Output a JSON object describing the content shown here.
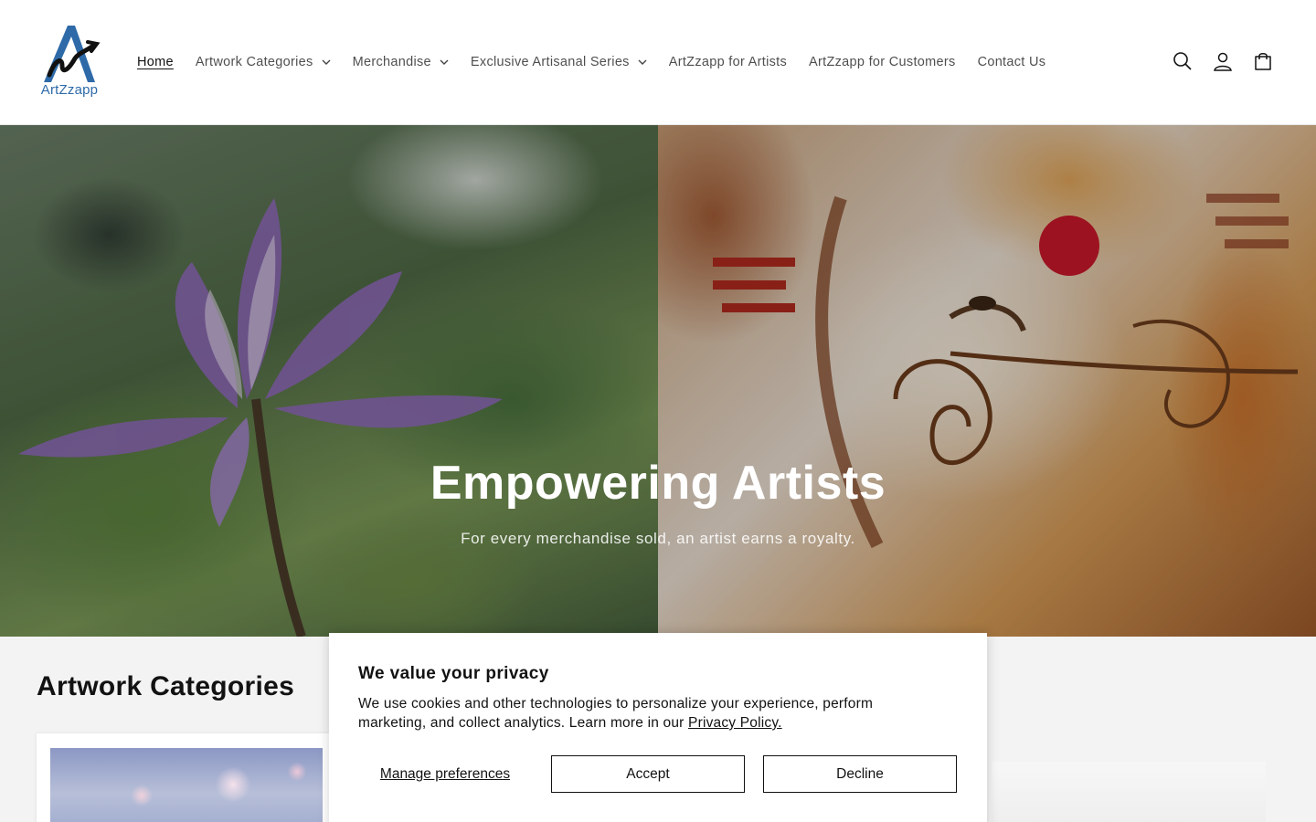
{
  "brand": {
    "name": "ArtZzapp",
    "logo_letter": "A"
  },
  "nav": {
    "items": [
      {
        "label": "Home",
        "dropdown": false,
        "active": true
      },
      {
        "label": "Artwork Categories",
        "dropdown": true
      },
      {
        "label": "Merchandise",
        "dropdown": true
      },
      {
        "label": "Exclusive Artisanal Series",
        "dropdown": true
      },
      {
        "label": "ArtZzapp for Artists",
        "dropdown": false
      },
      {
        "label": "ArtZzapp for Customers",
        "dropdown": false
      },
      {
        "label": "Contact Us",
        "dropdown": false
      }
    ],
    "icons": [
      "search-icon",
      "account-icon",
      "cart-icon"
    ]
  },
  "hero": {
    "title": "Empowering Artists",
    "subtitle": "For every merchandise sold, an artist earns a royalty."
  },
  "section": {
    "title": "Artwork Categories"
  },
  "cookie": {
    "title": "We value your privacy",
    "text": "We use cookies and other technologies to personalize your experience, perform marketing, and collect analytics. Learn more in our ",
    "link": "Privacy Policy.",
    "manage": "Manage preferences",
    "accept": "Accept",
    "decline": "Decline"
  }
}
